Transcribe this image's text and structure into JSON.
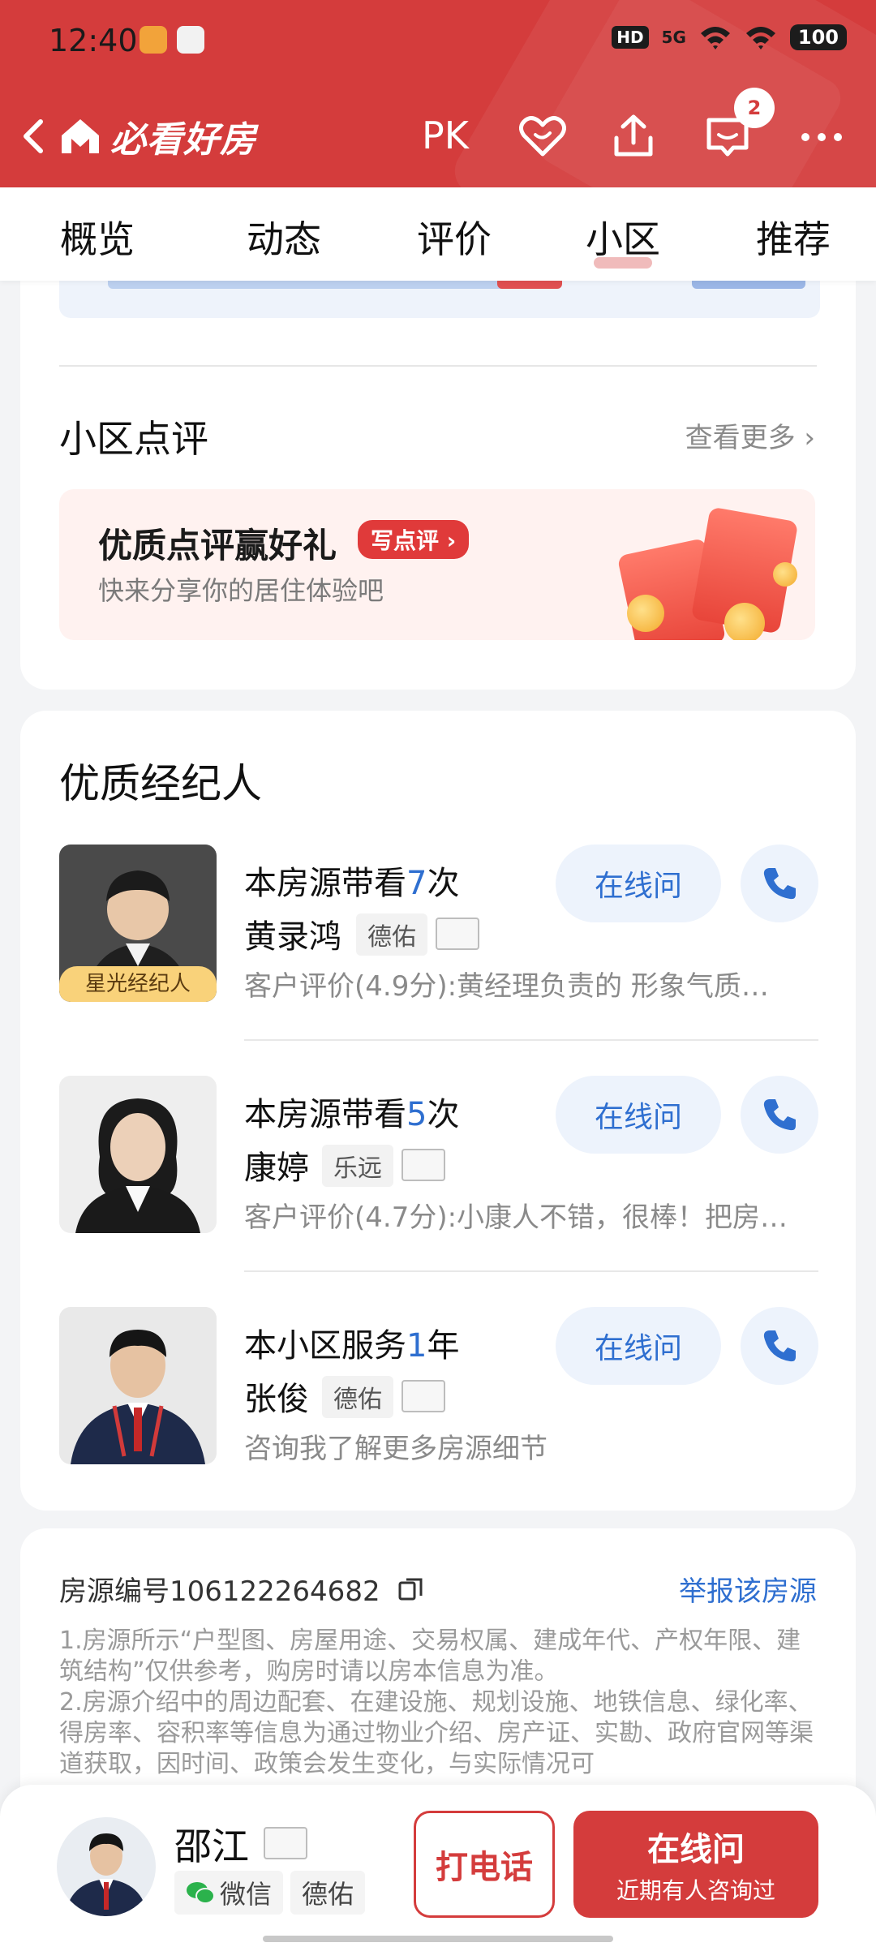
{
  "status_bar": {
    "time": "12:40",
    "hd": "HD",
    "signal": "5G",
    "battery": "100"
  },
  "header": {
    "app_name": "必看好房",
    "pk": "PK",
    "message_count": "2"
  },
  "tabs": [
    {
      "label": "概览"
    },
    {
      "label": "动态"
    },
    {
      "label": "评价"
    },
    {
      "label": "小区",
      "active": true
    },
    {
      "label": "推荐"
    }
  ],
  "community_review": {
    "title": "小区点评",
    "more": "查看更多",
    "promo_title": "优质点评赢好礼",
    "promo_tag": "写点评",
    "promo_sub": "快来分享你的居住体验吧"
  },
  "agents_section": {
    "title": "优质经纪人",
    "online_label": "在线问",
    "agents": [
      {
        "stat_prefix": "本房源带看",
        "stat_num": "7",
        "stat_suffix": "次",
        "name": "黄录鸿",
        "company": "德佑",
        "review": "客户评价(4.9分):黄经理负责的 形象气质…",
        "badge": "星光经纪人"
      },
      {
        "stat_prefix": "本房源带看",
        "stat_num": "5",
        "stat_suffix": "次",
        "name": "康婷",
        "company": "乐远",
        "review": "客户评价(4.7分):小康人不错，很棒！把房…"
      },
      {
        "stat_prefix": "本小区服务",
        "stat_num": "1",
        "stat_suffix": "年",
        "name": "张俊",
        "company": "德佑",
        "review": "咨询我了解更多房源细节"
      }
    ]
  },
  "listing": {
    "id_text": "房源编号106122264682",
    "report": "举报该房源",
    "disclaimer_1": "1.房源所示“户型图、房屋用途、交易权属、建成年代、产权年限、建筑结构”仅供参考，购房时请以房本信息为准。",
    "disclaimer_2": "2.房源介绍中的周边配套、在建设施、规划设施、地铁信息、绿化率、得房率、容积率等信息为通过物业介绍、房产证、实勘、政府官网等渠道获取，因时间、政策会发生变化，与实际情况可"
  },
  "bottom_bar": {
    "agent_name": "邵江",
    "wechat": "微信",
    "company": "德佑",
    "call": "打电话",
    "online": "在线问",
    "online_sub": "近期有人咨询过"
  },
  "colors": {
    "brand_red": "#d43c3c",
    "link_blue": "#2f6fd0"
  }
}
